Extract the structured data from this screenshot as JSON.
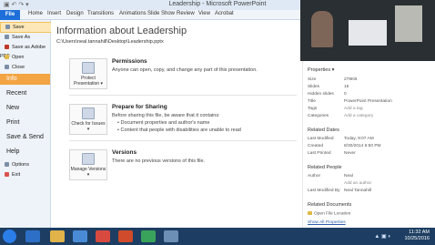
{
  "window": {
    "title": "Leadership - Microsoft PowerPoint",
    "qat": "▣ ↶ ↷ ▾"
  },
  "ribbon": {
    "file": "File",
    "tabs": [
      "Home",
      "Insert",
      "Design",
      "Transitions",
      "Animations",
      "Slide Show",
      "Review",
      "View",
      "Acrobat"
    ]
  },
  "sidebar": {
    "items": [
      "Save",
      "Save As",
      "Save as Adobe PDF",
      "Open",
      "Close"
    ],
    "info": "Info",
    "big": [
      "Recent",
      "New",
      "Print",
      "Save & Send",
      "Help"
    ],
    "small": [
      "Options",
      "Exit"
    ]
  },
  "main": {
    "title": "Information about Leadership",
    "path": "C:\\Users\\neal.tannahill\\Desktop\\Leadership.pptx",
    "cards": {
      "permissions": "Protect Presentation ▾",
      "sharing": "Check for Issues ▾",
      "versions": "Manage Versions ▾"
    },
    "permissions": {
      "title": "Permissions",
      "text": "Anyone can open, copy, and change any part of this presentation."
    },
    "sharing": {
      "title": "Prepare for Sharing",
      "text": "Before sharing this file, be aware that it contains:",
      "bullets": [
        "Document properties and author's name",
        "Content that people with disabilities are unable to read"
      ]
    },
    "versions": {
      "title": "Versions",
      "text": "There are no previous versions of this file."
    }
  },
  "properties": {
    "heading": "Properties ▾",
    "rows": [
      {
        "key": "Size",
        "value": "278KB"
      },
      {
        "key": "Slides",
        "value": "15"
      },
      {
        "key": "Hidden slides",
        "value": "0"
      },
      {
        "key": "Title",
        "value": "PowerPoint Presentation"
      },
      {
        "key": "Tags",
        "value": "Add a tag"
      },
      {
        "key": "Categories",
        "value": "Add a category"
      }
    ],
    "related_dates": {
      "heading": "Related Dates",
      "rows": [
        {
          "key": "Last Modified",
          "value": "Today, 9:07 AM"
        },
        {
          "key": "Created",
          "value": "8/30/2014 6:50 PM"
        },
        {
          "key": "Last Printed",
          "value": "Never"
        }
      ]
    },
    "related_people": {
      "heading": "Related People",
      "rows": [
        {
          "key": "Author",
          "value": "Neal"
        },
        {
          "key": "",
          "value": "Add an author"
        },
        {
          "key": "Last Modified By",
          "value": "Neal Tannahill"
        }
      ]
    },
    "related_documents": {
      "heading": "Related Documents",
      "open_location": "Open File Location",
      "show_all": "Show All Properties"
    }
  },
  "taskbar": {
    "time": "11:32 AM",
    "date": "10/25/2016"
  },
  "colors": {
    "file_tab": "#1e6fd9",
    "info_active": "#f3a443",
    "taskbar": "#1d3e62"
  }
}
